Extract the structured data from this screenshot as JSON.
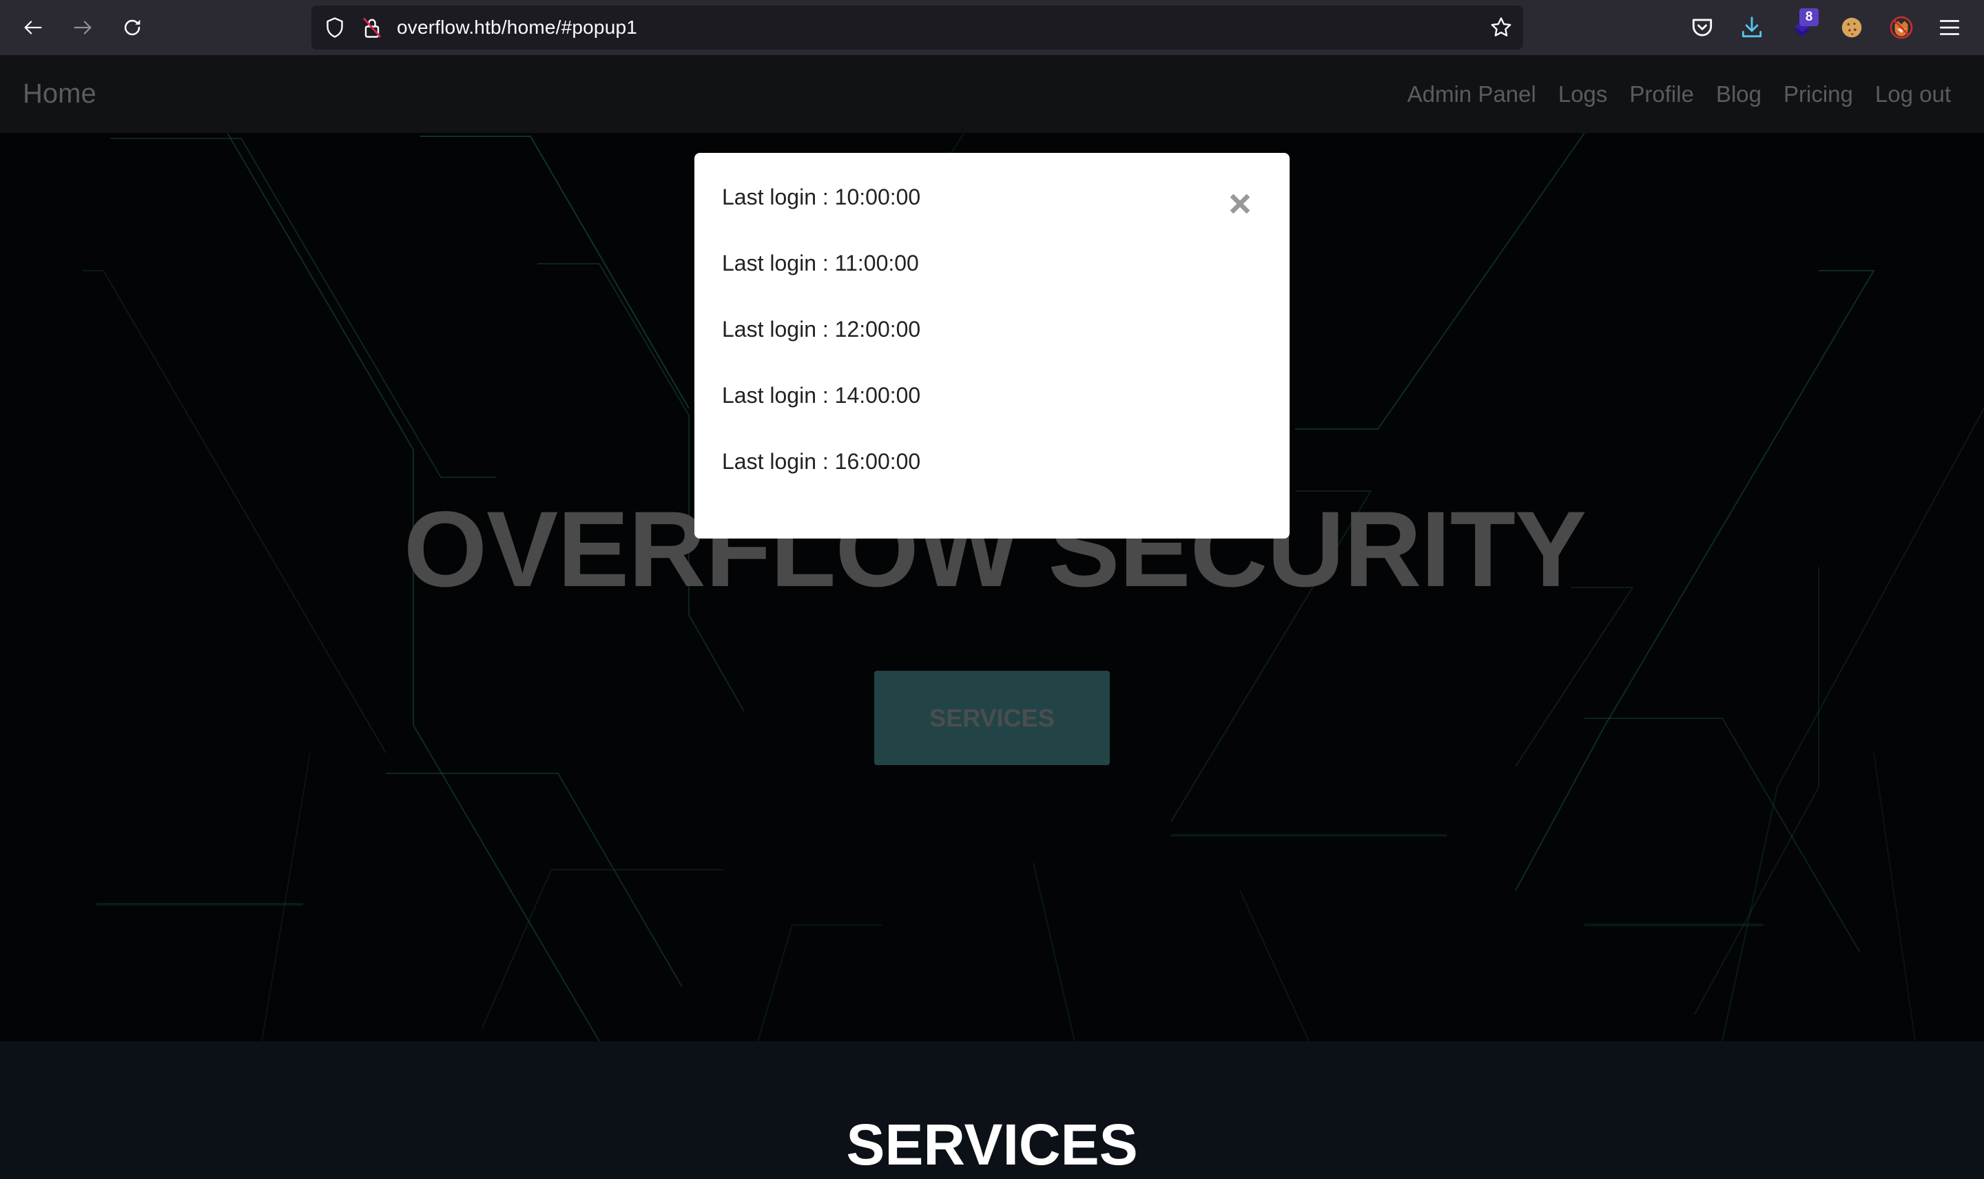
{
  "browser": {
    "url": "overflow.htb/home/#popup1",
    "toolbar_icons": [
      "back-arrow-icon",
      "forward-arrow-icon",
      "reload-icon"
    ],
    "url_icons": [
      "tracking-shield-icon",
      "insecure-lock-icon",
      "bookmark-star-icon"
    ],
    "extensions": [
      {
        "name": "pocket-icon"
      },
      {
        "name": "download-icon",
        "color": "#54c7ec"
      },
      {
        "name": "extension-stack-icon",
        "badge": "8",
        "color": "#3a1fa8"
      },
      {
        "name": "cookie-icon"
      },
      {
        "name": "foxy-proxy-disabled-icon"
      },
      {
        "name": "hamburger-menu-icon"
      }
    ]
  },
  "nav": {
    "brand": "Home",
    "links": [
      "Admin Panel",
      "Logs",
      "Profile",
      "Blog",
      "Pricing",
      "Log out"
    ]
  },
  "hero": {
    "title": "OVERFLOW SECURITY",
    "button_label": "SERVICES"
  },
  "services": {
    "title": "SERVICES"
  },
  "popup": {
    "entries": [
      "Last login : 10:00:00",
      "Last login : 11:00:00",
      "Last login : 12:00:00",
      "Last login : 14:00:00",
      "Last login : 16:00:00"
    ],
    "close_icon": "close-x-icon"
  },
  "colors": {
    "toolbar_bg": "#2b2a33",
    "urlbar_bg": "#1c1b22",
    "nav_bg": "#111214",
    "nav_text": "#5c5c5c",
    "hero_bg": "#020405",
    "circuit_line": "#1f5a55",
    "hero_button_bg": "#234447",
    "services_bg": "#0c1117",
    "popup_bg": "#ffffff",
    "popup_text": "#222222",
    "close_icon": "#999999"
  }
}
